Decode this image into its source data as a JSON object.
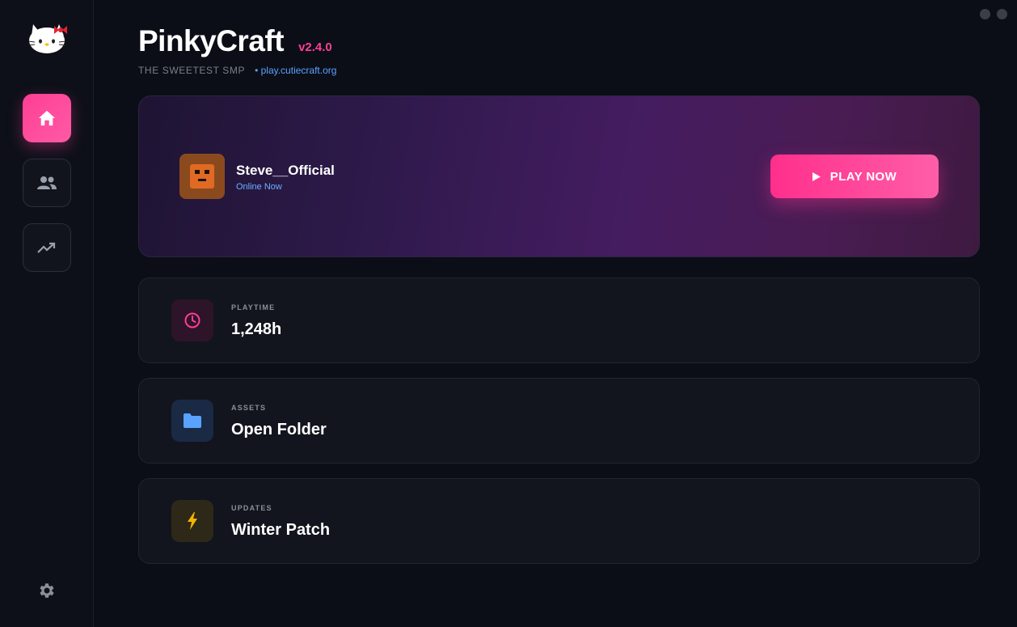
{
  "app": {
    "title": "PinkyCraft",
    "version": "v2.4.0",
    "tagline": "THE SWEETEST SMP",
    "server": "• play.cutiecraft.org"
  },
  "sidebar": {
    "items": [
      {
        "icon": "home-icon",
        "active": true
      },
      {
        "icon": "friends-icon",
        "active": false
      },
      {
        "icon": "stats-trending-icon",
        "active": false
      }
    ],
    "settings_icon": "gear-icon"
  },
  "hero": {
    "player_name": "Steve__Official",
    "player_status": "Online Now",
    "play_label": "PLAY NOW"
  },
  "cards": [
    {
      "label": "PLAYTIME",
      "value": "1,248h",
      "icon": "clock-icon"
    },
    {
      "label": "ASSETS",
      "value": "Open Folder",
      "icon": "folder-icon"
    },
    {
      "label": "UPDATES",
      "value": "Winter Patch",
      "icon": "lightning-icon"
    }
  ],
  "colors": {
    "accent": "#ff3d96",
    "link": "#5aa2ff",
    "background": "#0b0e17"
  }
}
